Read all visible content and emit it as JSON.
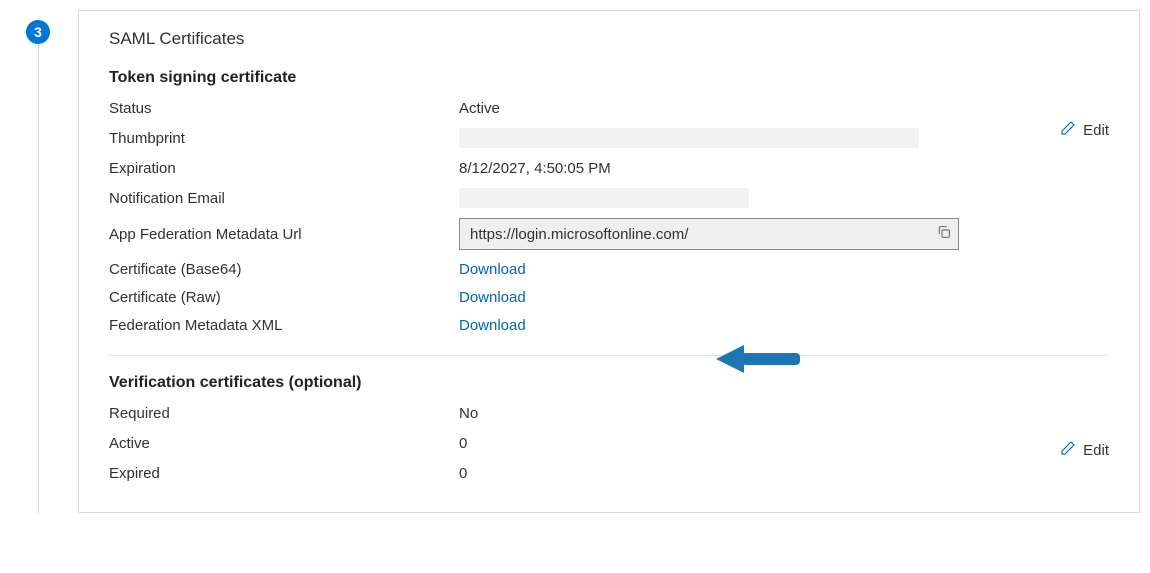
{
  "step": {
    "number": "3"
  },
  "card": {
    "title": "SAML Certificates",
    "edit_label": "Edit",
    "token": {
      "heading": "Token signing certificate",
      "status_label": "Status",
      "status_value": "Active",
      "thumbprint_label": "Thumbprint",
      "expiration_label": "Expiration",
      "expiration_value": "8/12/2027, 4:50:05 PM",
      "notif_label": "Notification Email",
      "metadata_url_label": "App Federation Metadata Url",
      "metadata_url_value": "https://login.microsoftonline.com/",
      "cert_b64_label": "Certificate (Base64)",
      "cert_raw_label": "Certificate (Raw)",
      "fed_xml_label": "Federation Metadata XML",
      "download_label": "Download"
    },
    "verify": {
      "heading": "Verification certificates (optional)",
      "required_label": "Required",
      "required_value": "No",
      "active_label": "Active",
      "active_value": "0",
      "expired_label": "Expired",
      "expired_value": "0"
    }
  },
  "colors": {
    "accent": "#0078d4",
    "link": "#0066b8",
    "arrow": "#1b76b3"
  }
}
